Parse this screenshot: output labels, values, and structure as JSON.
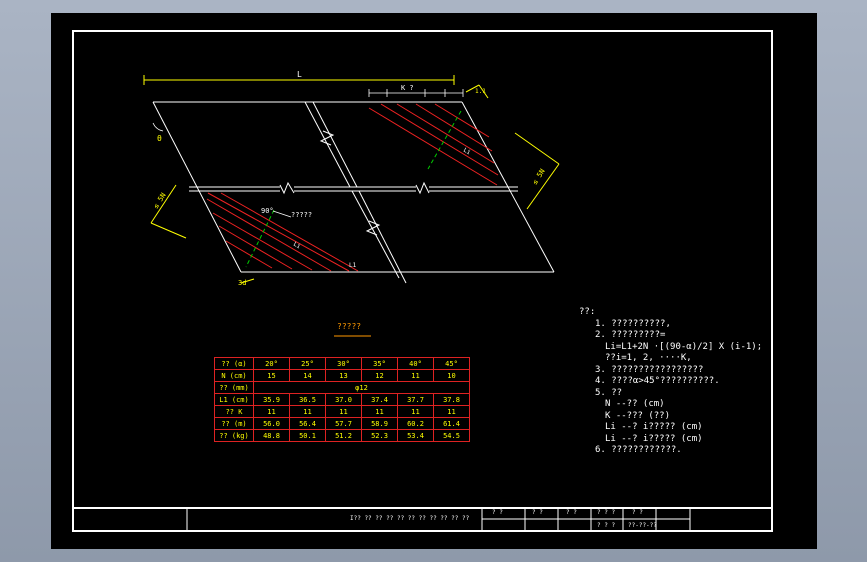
{
  "drawing": {
    "label_L": "L",
    "label_K": "K ?",
    "label_theta": "θ",
    "label_90": "90°",
    "label_rebar_note": "?????",
    "label_d_left": "≤ 5N",
    "label_d_right": "≤ 5N",
    "label_d_bottom": "3d",
    "label_d_top": "1.1",
    "label_li_1": "Li",
    "label_li_2": "Li",
    "label_li_3": "L1"
  },
  "table": {
    "title": "?????",
    "rows": [
      {
        "head": "?? (α)",
        "cells": [
          "20°",
          "25°",
          "30°",
          "35°",
          "40°",
          "45°"
        ]
      },
      {
        "head": "N (cm)",
        "cells": [
          "15",
          "14",
          "13",
          "12",
          "11",
          "10"
        ]
      },
      {
        "head": "?? (mm)",
        "cells": [
          "φ12"
        ]
      },
      {
        "head": "L1 (cm)",
        "cells": [
          "35.9",
          "36.5",
          "37.0",
          "37.4",
          "37.7",
          "37.8"
        ]
      },
      {
        "head": "?? K",
        "cells": [
          "11",
          "11",
          "11",
          "11",
          "11",
          "11"
        ]
      },
      {
        "head": "?? (m)",
        "cells": [
          "56.0",
          "56.4",
          "57.7",
          "58.9",
          "60.2",
          "61.4"
        ]
      },
      {
        "head": "?? (kg)",
        "cells": [
          "48.8",
          "50.1",
          "51.2",
          "52.3",
          "53.4",
          "54.5"
        ]
      }
    ]
  },
  "notes": {
    "heading": "??:",
    "lines": [
      "1. ??????????,",
      "2. ?????????=",
      "Li=L1+2N ·[(90-α)/2] X (i-1);",
      "??i=1, 2, ····K,",
      "3. ?????????????????",
      "4. ????α>45°??????????.",
      "5. ??",
      "N --?? (cm)",
      "K --??? (??)",
      "Li --? i????? (cm)",
      "Li --? i????? (cm)",
      "6. ????????????."
    ]
  },
  "title_block": {
    "drawing_title": "I?? ?? ?? ?? ?? ?? ?? ?? ?? ?? ??",
    "cells": [
      "? ?",
      "? ?",
      "? ?",
      "? ? ?",
      "? ?",
      "? ? ?",
      "??-??-??"
    ]
  }
}
